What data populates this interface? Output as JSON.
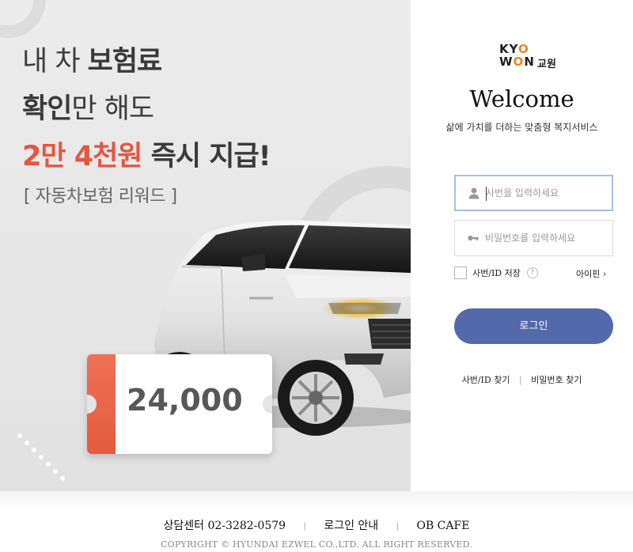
{
  "banner": {
    "headline_line1_prefix": "내 차 ",
    "headline_line1_bold": "보험료",
    "headline_line2_bold": "확인",
    "headline_line2_rest": "만 해도",
    "headline_line3_accent": "2만 4천원",
    "headline_line3_rest": " 즉시 지급!",
    "subtag": "[ 자동차보험 리워드 ]",
    "ticket_amount": "24,000",
    "accent_color": "#e5563d"
  },
  "login": {
    "logo_text_line1_a": "KY",
    "logo_text_line1_o": "O",
    "logo_text_line2_a": "W",
    "logo_text_line2_o": "O",
    "logo_text_line2_b": "N",
    "logo_edu": "교원",
    "welcome": "Welcome",
    "tagline": "삶에 가치를 더하는 맞춤형 복지서비스",
    "id_placeholder": "사번을 입력하세요",
    "pw_placeholder": "비밀번호를 입력하세요",
    "remember_label": "사번/ID 저장",
    "help_icon_text": "?",
    "id_link": "아이핀 ›",
    "login_button": "로그인",
    "find_id": "사번/ID 찾기",
    "find_pw": "비밀번호 찾기",
    "separator": "|",
    "button_color": "#5469aa"
  },
  "footer": {
    "contact": "상담센터 02-3282-0579",
    "login_guide": "로그인 안내",
    "cafe": "OB CAFE",
    "separator": "|",
    "copyright": "COPYRIGHT © HYUNDAI EZWEL CO.,LTD. ALL RIGHT RESERVED."
  },
  "icons": {
    "user": "user-icon",
    "key": "key-icon",
    "help": "help-icon"
  }
}
